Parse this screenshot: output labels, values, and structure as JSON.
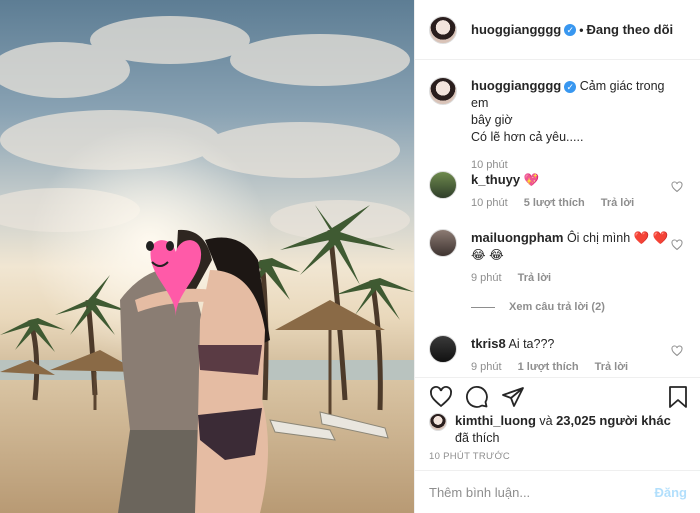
{
  "header": {
    "username": "huoggiangggg",
    "verified": true,
    "separator": "•",
    "follow_status": "Đang theo dõi"
  },
  "caption": {
    "username": "huoggiangggg",
    "text_line1": "Cảm giác trong em",
    "text_line2": "bây giờ",
    "text_line3": "Có lẽ hơn cả yêu.....",
    "time": "10 phút"
  },
  "comments": [
    {
      "username": "k_thuyy",
      "text": "💖",
      "time": "10 phút",
      "likes": "5 lượt thích",
      "reply": "Trả lời"
    },
    {
      "username": "mailuongpham",
      "text": "Ôi chị mình ❤️ ❤️",
      "text2": "😂 😂",
      "time": "9 phút",
      "reply": "Trả lời"
    },
    {
      "username": "tkris8",
      "text": "Ai ta???",
      "time": "9 phút",
      "likes": "1 lượt thích",
      "reply": "Trả lời"
    }
  ],
  "view_replies": "Xem câu trả lời (2)",
  "likes": {
    "user": "kimthi_luong",
    "and": "và",
    "count_text": "23,025 người khác",
    "liked": "đã thích"
  },
  "timestamp": "10 phút trước",
  "add_comment": {
    "placeholder": "Thêm bình luận...",
    "post_label": "Đăng"
  },
  "colors": {
    "verified": "#3897f0",
    "muted": "#8e8e8e",
    "post_button": "#b2dffc",
    "heart_sticker": "#ff5aa8"
  }
}
